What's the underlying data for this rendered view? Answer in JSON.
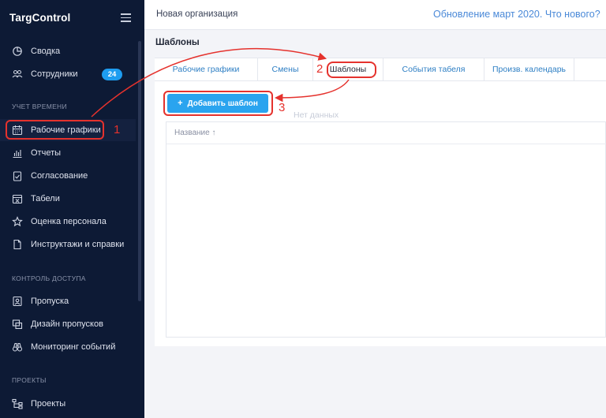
{
  "app": {
    "brand": "TargControl"
  },
  "header": {
    "org_name": "Новая организация",
    "update_link": "Обновление март 2020. Что нового?"
  },
  "sidebar": {
    "items": [
      {
        "label": "Сводка",
        "icon": "dashboard-icon"
      },
      {
        "label": "Сотрудники",
        "icon": "users-icon",
        "badge": "24"
      }
    ],
    "section_time": "УЧЕТ ВРЕМЕНИ",
    "time_items": [
      {
        "label": "Рабочие графики",
        "icon": "calendar-icon",
        "active": true
      },
      {
        "label": "Отчеты",
        "icon": "bar-chart-icon"
      },
      {
        "label": "Согласование",
        "icon": "clipboard-check-icon"
      },
      {
        "label": "Табели",
        "icon": "calendar-x-icon"
      },
      {
        "label": "Оценка персонала",
        "icon": "star-icon"
      },
      {
        "label": "Инструктажи и справки",
        "icon": "document-icon"
      }
    ],
    "section_access": "КОНТРОЛЬ ДОСТУПА",
    "access_items": [
      {
        "label": "Пропуска",
        "icon": "badge-icon"
      },
      {
        "label": "Дизайн пропусков",
        "icon": "design-icon"
      },
      {
        "label": "Мониторинг событий",
        "icon": "binoculars-icon"
      }
    ],
    "section_projects": "ПРОЕКТЫ",
    "project_items": [
      {
        "label": "Проекты",
        "icon": "hierarchy-icon"
      }
    ]
  },
  "main": {
    "title": "Шаблоны",
    "tabs": [
      {
        "label": "Рабочие графики"
      },
      {
        "label": "Смены"
      },
      {
        "label": "Шаблоны",
        "active": true
      },
      {
        "label": "События табеля"
      },
      {
        "label": "Произв. календарь"
      }
    ],
    "add_button": "Добавить шаблон",
    "table": {
      "column_name": "Название ↑",
      "empty_text": "Нет данных"
    }
  },
  "annotations": {
    "step1": "1",
    "step2": "2",
    "step3": "3"
  },
  "colors": {
    "sidebar": "#0d1a35",
    "accent": "#2aa4ef",
    "annotation": "#e5322d",
    "link": "#4a89d8"
  }
}
